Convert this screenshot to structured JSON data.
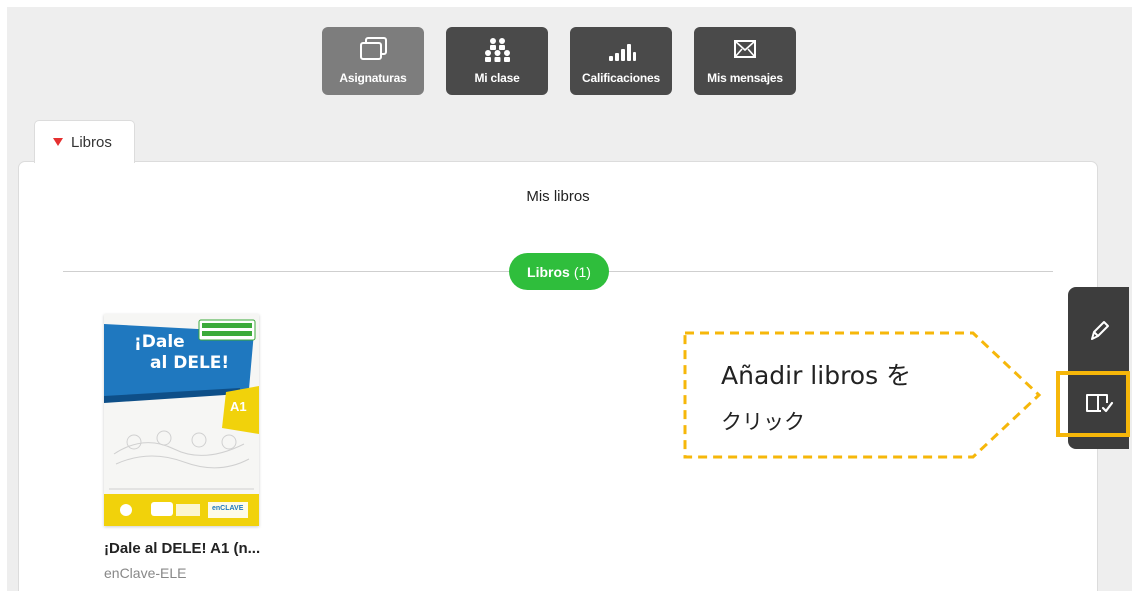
{
  "nav": [
    {
      "label": "Asignaturas",
      "icon": "subjects-icon",
      "active": true
    },
    {
      "label": "Mi clase",
      "icon": "class-icon",
      "active": false
    },
    {
      "label": "Calificaciones",
      "icon": "grades-icon",
      "active": false
    },
    {
      "label": "Mis mensajes",
      "icon": "messages-icon",
      "active": false
    }
  ],
  "tab": {
    "label": "Libros"
  },
  "panel": {
    "title": "Mis libros",
    "pill_label": "Libros",
    "pill_count": "(1)"
  },
  "book": {
    "title": "¡Dale al DELE! A1 (n...",
    "publisher": "enClave-ELE",
    "cover": {
      "title_line1": "¡Dale",
      "title_line2": "al DELE!",
      "level": "A1",
      "badge": "NUEVO MODELO DE EXAMEN",
      "brand": "enCLAVE"
    }
  },
  "callout": {
    "line1": "Añadir libros を",
    "line2": "クリック"
  },
  "toolbar": {
    "edit_icon": "pencil-icon",
    "add_icon": "add-books-icon"
  },
  "colors": {
    "nav_bg": "#4a4a4a",
    "nav_active": "#7d7d7d",
    "pill": "#2fbe3c",
    "highlight": "#f6b70a",
    "tab_triangle": "#e53030"
  }
}
